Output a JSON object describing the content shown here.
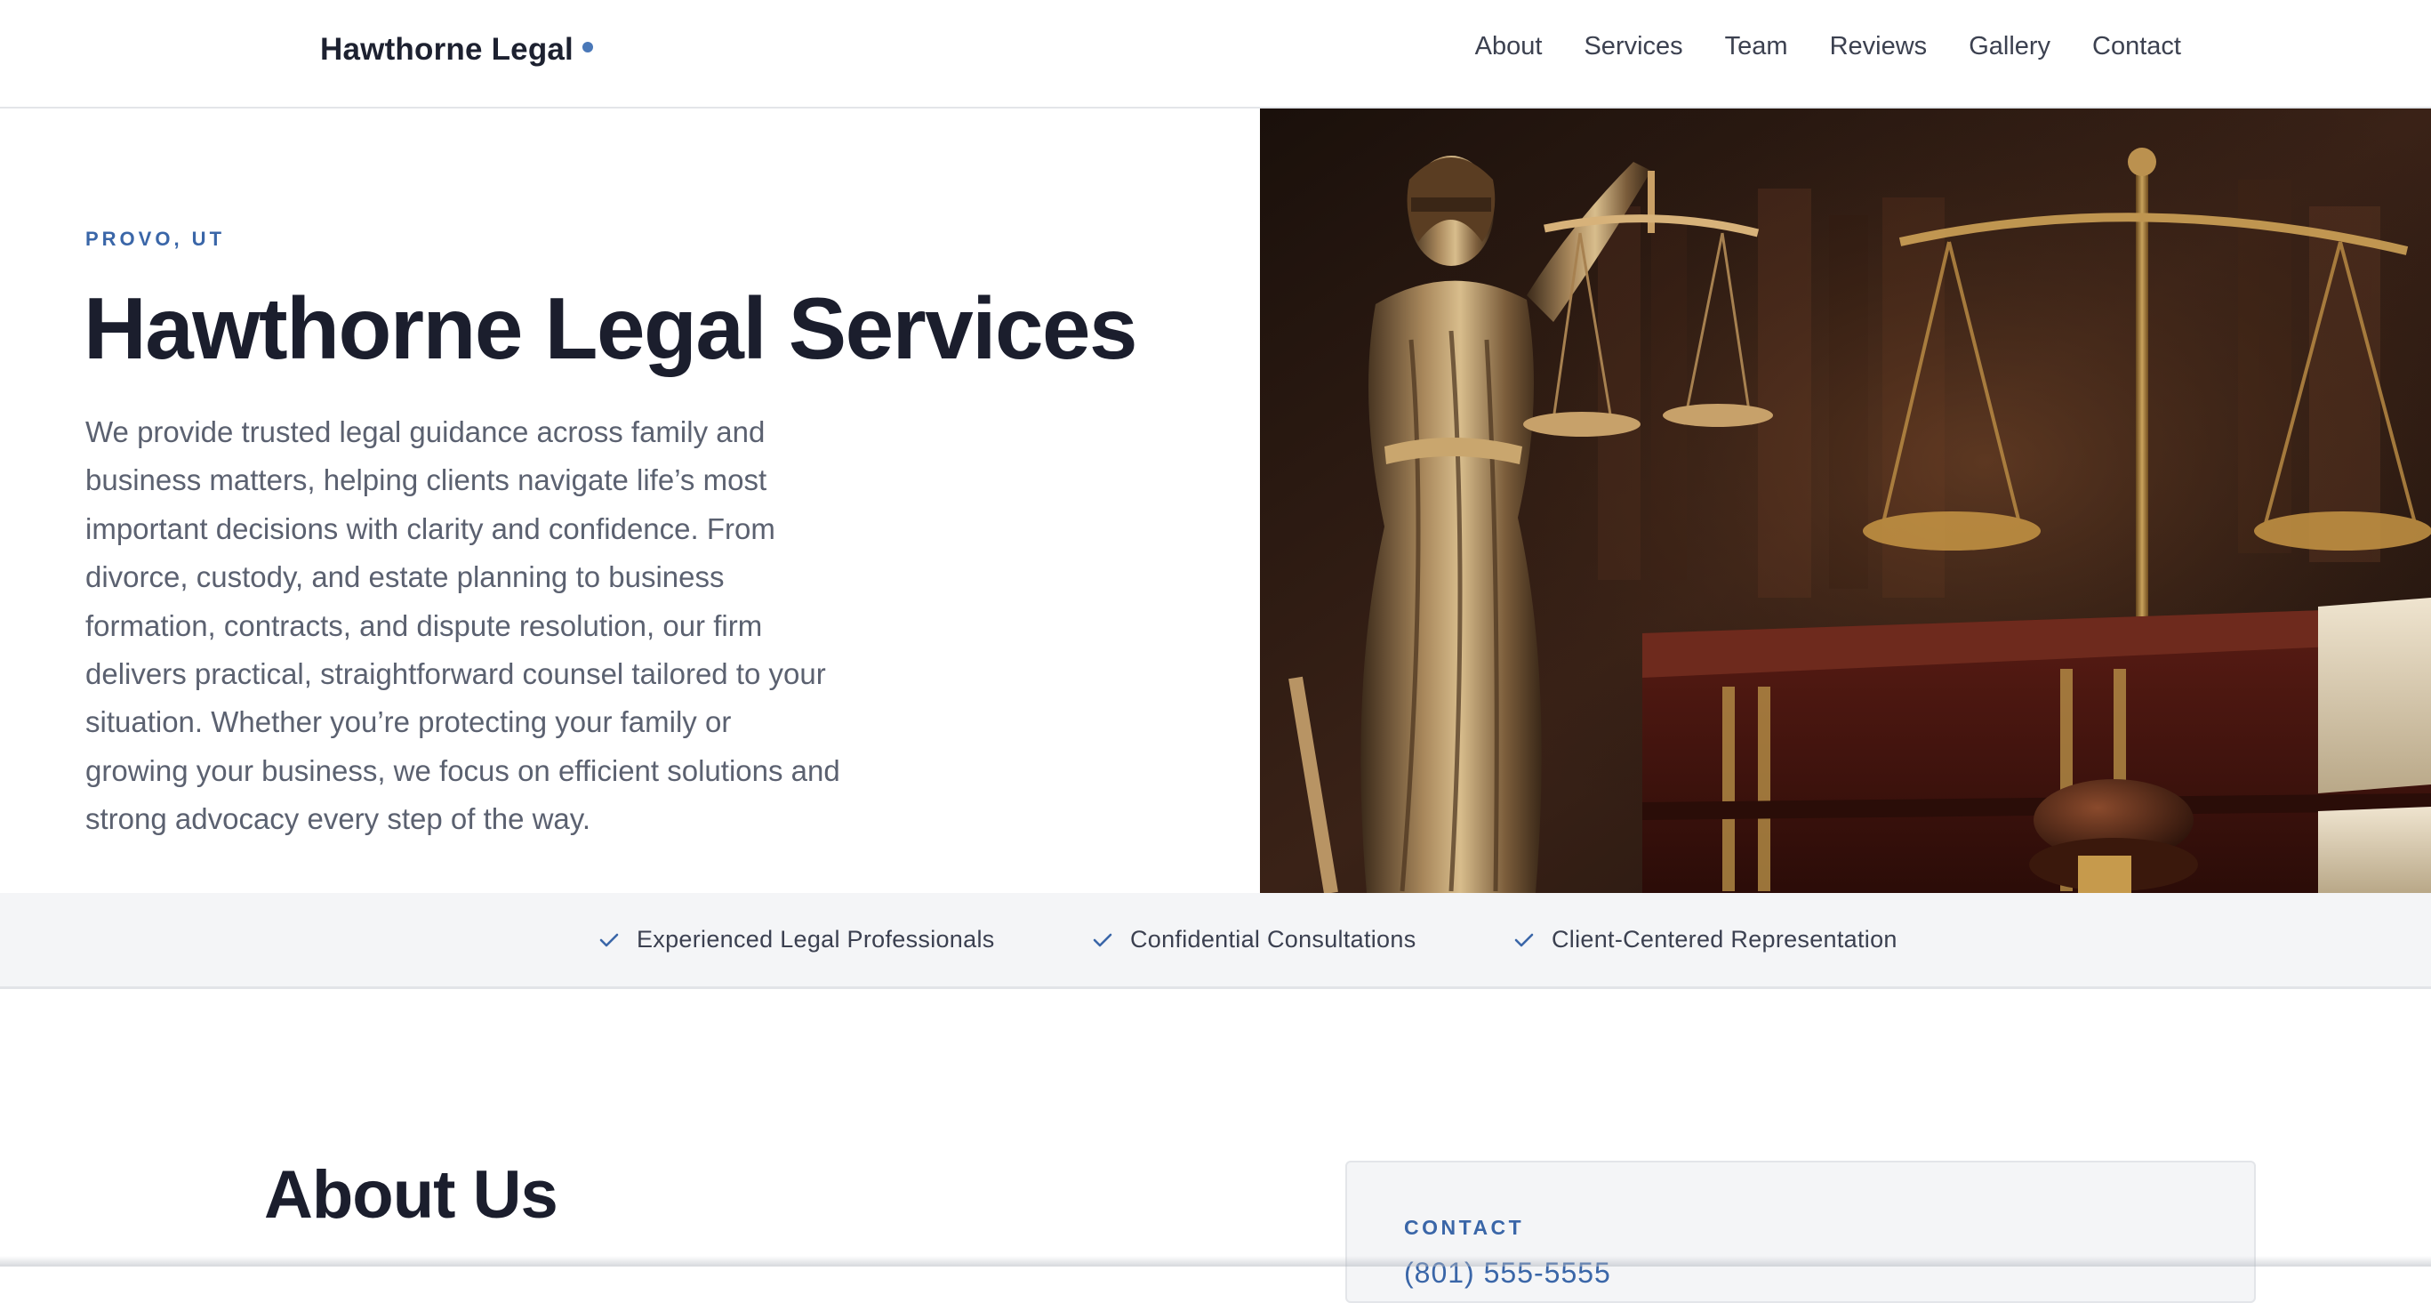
{
  "header": {
    "brand": "Hawthorne Legal",
    "nav": [
      "About",
      "Services",
      "Team",
      "Reviews",
      "Gallery",
      "Contact"
    ]
  },
  "hero": {
    "eyebrow": "PROVO, UT",
    "title": "Hawthorne Legal Services",
    "description": "We provide trusted legal guidance across family and business matters, helping clients navigate life’s most important decisions with clarity and confidence. From divorce, custody, and estate planning to business formation, contracts, and dispute resolution, our firm delivers practical, straightforward counsel tailored to your situation. Whether you’re protecting your family or growing your business, we focus on efficient solutions and strong advocacy every step of the way."
  },
  "features": [
    "Experienced Legal Professionals",
    "Confidential Consultations",
    "Client-Centered Representation"
  ],
  "about": {
    "title": "About Us"
  },
  "contact": {
    "label": "CONTACT",
    "phone": "(801) 555-5555"
  },
  "colors": {
    "accent": "#3a66a8",
    "heading": "#1b1e2d",
    "body_text": "#5b6170",
    "band_bg": "#f4f5f7"
  },
  "icons": [
    "check-icon",
    "brand-dot-icon"
  ]
}
